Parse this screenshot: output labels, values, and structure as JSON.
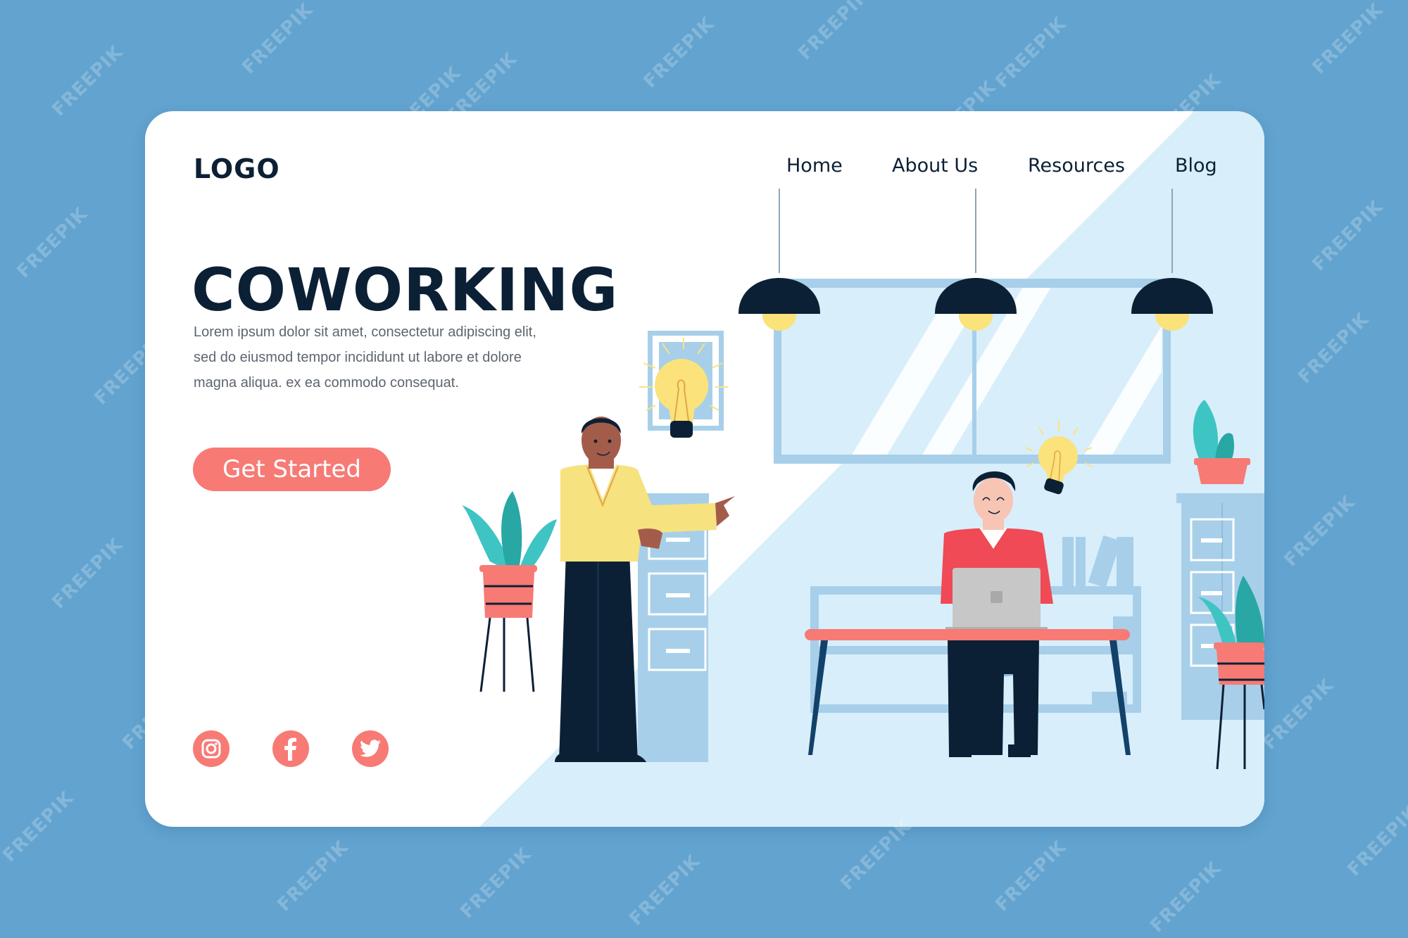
{
  "logo": "LOGO",
  "nav": {
    "items": [
      {
        "label": "Home"
      },
      {
        "label": "About Us"
      },
      {
        "label": "Resources"
      },
      {
        "label": "Blog"
      }
    ]
  },
  "hero": {
    "title": "COWORKING",
    "description_lines": [
      "Lorem ipsum dolor sit amet, consectetur adipiscing elit,",
      "sed do eiusmod tempor incididunt ut labore et dolore",
      "magna aliqua. ex ea commodo consequat."
    ],
    "cta_label": "Get Started"
  },
  "social": [
    {
      "icon": "instagram-icon",
      "label": "Instagram"
    },
    {
      "icon": "facebook-icon",
      "label": "Facebook"
    },
    {
      "icon": "twitter-icon",
      "label": "Twitter"
    }
  ],
  "illustration": {
    "scene": "coworking office",
    "elements": [
      "pendant-lamps",
      "window",
      "framed-lightbulb-picture",
      "lightbulb-idea",
      "standing-man-yellow-sweater",
      "seated-man-red-sweater",
      "laptop",
      "desk",
      "filing-cabinets",
      "potted-plants",
      "bookshelf"
    ]
  },
  "watermark_text": "FREEPIK",
  "colors": {
    "page_background": "#62a3cf",
    "card_background": "#ffffff",
    "illustration_background": "#d8eefb",
    "accent": "#f77a75",
    "text_dark": "#0c2035",
    "text_muted": "#5d6570",
    "lamp_bulb": "#fbe27a",
    "plant_teal": "#3fc4c4",
    "furniture_blue": "#a7cfea"
  }
}
